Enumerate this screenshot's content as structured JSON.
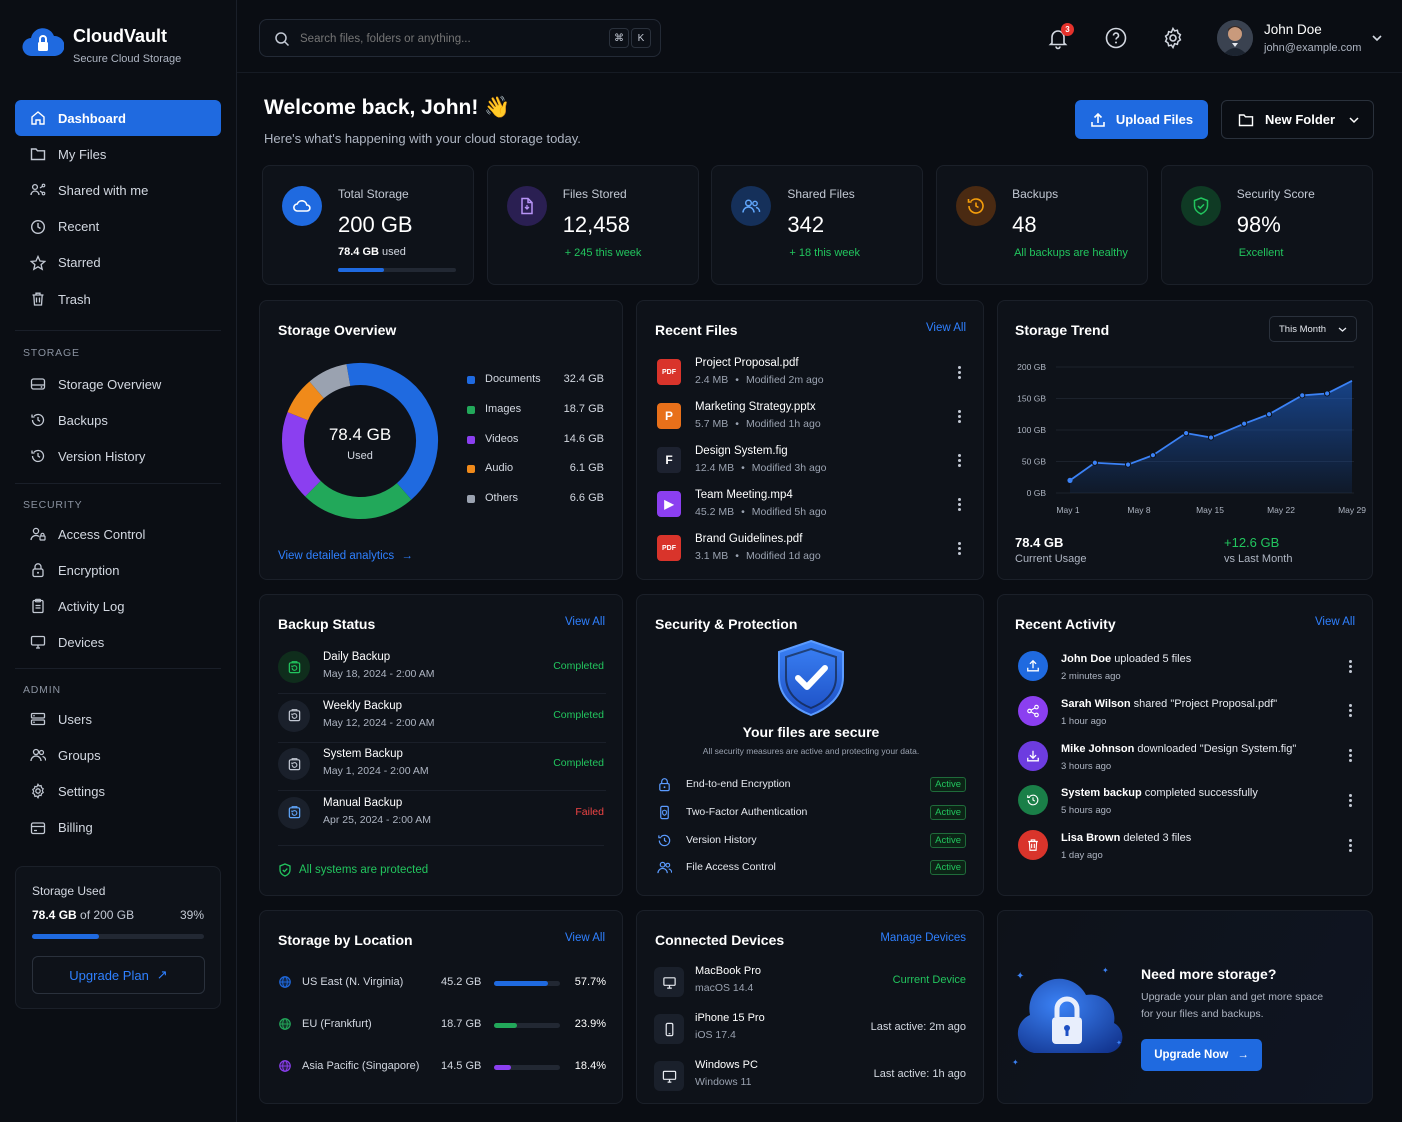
{
  "brand": {
    "name": "CloudVault",
    "tagline": "Secure Cloud Storage"
  },
  "nav": {
    "main": [
      {
        "label": "Dashboard",
        "icon": "home-icon",
        "active": true
      },
      {
        "label": "My Files",
        "icon": "folder-icon"
      },
      {
        "label": "Shared with me",
        "icon": "shared-users-icon"
      },
      {
        "label": "Recent",
        "icon": "clock-icon"
      },
      {
        "label": "Starred",
        "icon": "star-icon"
      },
      {
        "label": "Trash",
        "icon": "trash-icon"
      }
    ],
    "storage_heading": "STORAGE",
    "storage": [
      {
        "label": "Storage Overview",
        "icon": "hard-drive-icon"
      },
      {
        "label": "Backups",
        "icon": "backup-icon"
      },
      {
        "label": "Version History",
        "icon": "history-icon"
      }
    ],
    "security_heading": "SECURITY",
    "security": [
      {
        "label": "Access Control",
        "icon": "user-lock-icon"
      },
      {
        "label": "Encryption",
        "icon": "lock-icon"
      },
      {
        "label": "Activity Log",
        "icon": "clipboard-icon"
      },
      {
        "label": "Devices",
        "icon": "monitor-icon"
      }
    ],
    "admin_heading": "ADMIN",
    "admin": [
      {
        "label": "Users",
        "icon": "users-list-icon"
      },
      {
        "label": "Groups",
        "icon": "group-icon"
      },
      {
        "label": "Settings",
        "icon": "gear-icon"
      },
      {
        "label": "Billing",
        "icon": "wallet-icon"
      }
    ]
  },
  "sidebar_storage": {
    "title": "Storage Used",
    "used": "78.4 GB",
    "of": "of 200 GB",
    "percent_label": "39%",
    "percent": 0.39,
    "button": "Upgrade Plan"
  },
  "search": {
    "placeholder": "Search files, folders or anything...",
    "key1": "⌘",
    "key2": "K"
  },
  "notifications": {
    "count": "3"
  },
  "user": {
    "name": "John Doe",
    "email": "john@example.com"
  },
  "header": {
    "title": "Welcome back, John! 👋",
    "subtitle": "Here's what's happening with your cloud storage today.",
    "upload": "Upload Files",
    "new_folder": "New Folder"
  },
  "stats": [
    {
      "label": "Total Storage",
      "value": "200 GB",
      "sub": "78.4 GB",
      "sub_suffix": "used",
      "progress": 0.39
    },
    {
      "label": "Files Stored",
      "value": "12,458",
      "sub": "+ 245 this week"
    },
    {
      "label": "Shared Files",
      "value": "342",
      "sub": "+ 18 this week"
    },
    {
      "label": "Backups",
      "value": "48",
      "sub": "All backups are healthy"
    },
    {
      "label": "Security Score",
      "value": "98%",
      "sub": "Excellent"
    }
  ],
  "overview": {
    "title": "Storage Overview",
    "center_value": "78.4 GB",
    "center_label": "Used",
    "link": "View detailed analytics",
    "items": [
      {
        "label": "Documents",
        "value": "32.4 GB",
        "gb": 32.4,
        "color": "#1f6ae0"
      },
      {
        "label": "Images",
        "value": "18.7 GB",
        "gb": 18.7,
        "color": "#22a85a"
      },
      {
        "label": "Videos",
        "value": "14.6 GB",
        "gb": 14.6,
        "color": "#8b3ff0"
      },
      {
        "label": "Audio",
        "value": "6.1 GB",
        "gb": 6.1,
        "color": "#f08a1a"
      },
      {
        "label": "Others",
        "value": "6.6 GB",
        "gb": 6.6,
        "color": "#9aa2b0"
      }
    ]
  },
  "recent_files": {
    "title": "Recent Files",
    "view_all": "View All",
    "items": [
      {
        "name": "Project Proposal.pdf",
        "size": "2.4 MB",
        "modified": "Modified 2m ago",
        "icon": "pdf-icon",
        "color": "#d9342b",
        "glyph": "PDF"
      },
      {
        "name": "Marketing Strategy.pptx",
        "size": "5.7 MB",
        "modified": "Modified 1h ago",
        "icon": "pptx-icon",
        "color": "#e8701a",
        "glyph": "P"
      },
      {
        "name": "Design System.fig",
        "size": "12.4 MB",
        "modified": "Modified 3h ago",
        "icon": "figma-icon",
        "color": "#1d2230",
        "glyph": "F"
      },
      {
        "name": "Team Meeting.mp4",
        "size": "45.2 MB",
        "modified": "Modified 5h ago",
        "icon": "video-icon",
        "color": "#8b3ff0",
        "glyph": "▶"
      },
      {
        "name": "Brand Guidelines.pdf",
        "size": "3.1 MB",
        "modified": "Modified 1d ago",
        "icon": "pdf-icon",
        "color": "#d9342b",
        "glyph": "PDF"
      }
    ]
  },
  "trend": {
    "title": "Storage Trend",
    "period": "This Month",
    "current_value": "78.4 GB",
    "current_label": "Current Usage",
    "delta_value": "+12.6 GB",
    "delta_label": "vs Last Month"
  },
  "chart_data": {
    "type": "area",
    "y_ticks": [
      "200 GB",
      "150 GB",
      "100 GB",
      "50 GB",
      "0 GB"
    ],
    "ylim": [
      0,
      200
    ],
    "x_ticks": [
      "May 1",
      "May 8",
      "May 15",
      "May 22",
      "May 29"
    ],
    "x": [
      1,
      4,
      8,
      11,
      15,
      18,
      22,
      25,
      29,
      32,
      35
    ],
    "y": [
      20,
      48,
      45,
      60,
      95,
      88,
      110,
      125,
      155,
      158,
      178
    ]
  },
  "backup": {
    "title": "Backup Status",
    "view_all": "View All",
    "footer": "All systems are protected",
    "items": [
      {
        "name": "Daily Backup",
        "date": "May 18, 2024 - 2:00 AM",
        "status": "Completed",
        "ok": true
      },
      {
        "name": "Weekly Backup",
        "date": "May 12, 2024 - 2:00 AM",
        "status": "Completed",
        "ok": true
      },
      {
        "name": "System Backup",
        "date": "May 1, 2024 - 2:00 AM",
        "status": "Completed",
        "ok": true
      },
      {
        "name": "Manual Backup",
        "date": "Apr 25, 2024 - 2:00 AM",
        "status": "Failed",
        "ok": false
      }
    ]
  },
  "security": {
    "title": "Security & Protection",
    "heading": "Your files are secure",
    "sub": "All security measures are active and protecting your data.",
    "items": [
      {
        "label": "End-to-end Encryption",
        "status": "Active",
        "icon": "lock-icon"
      },
      {
        "label": "Two-Factor Authentication",
        "status": "Active",
        "icon": "phone-shield-icon"
      },
      {
        "label": "Version History",
        "status": "Active",
        "icon": "history-icon"
      },
      {
        "label": "File Access Control",
        "status": "Active",
        "icon": "users-icon"
      }
    ]
  },
  "activity": {
    "title": "Recent Activity",
    "view_all": "View All",
    "items": [
      {
        "actor": "John Doe",
        "action": "uploaded 5 files",
        "time": "2 minutes ago",
        "color": "#1f6ae0",
        "icon": "upload-icon"
      },
      {
        "actor": "Sarah Wilson",
        "action": "shared \"Project Proposal.pdf\"",
        "time": "1 hour ago",
        "color": "#8b3ff0",
        "icon": "share-icon"
      },
      {
        "actor": "Mike Johnson",
        "action": "downloaded \"Design System.fig\"",
        "time": "3 hours ago",
        "color": "#6d3ce0",
        "icon": "download-icon"
      },
      {
        "actor": "System backup",
        "action": "completed successfully",
        "time": "5 hours ago",
        "color": "#1a7f48",
        "icon": "backup-icon"
      },
      {
        "actor": "Lisa Brown",
        "action": "deleted 3 files",
        "time": "1 day ago",
        "color": "#d9342b",
        "icon": "trash-icon"
      }
    ]
  },
  "locations": {
    "title": "Storage by Location",
    "view_all": "View All",
    "items": [
      {
        "name": "US East (N. Virginia)",
        "size": "45.2 GB",
        "percent": "57.7%",
        "fraction": 0.577,
        "color": "#1f6ae0"
      },
      {
        "name": "EU (Frankfurt)",
        "size": "18.7 GB",
        "percent": "23.9%",
        "fraction": 0.239,
        "color": "#22a85a"
      },
      {
        "name": "Asia Pacific (Singapore)",
        "size": "14.5 GB",
        "percent": "18.4%",
        "fraction": 0.184,
        "color": "#8b3ff0"
      }
    ]
  },
  "devices": {
    "title": "Connected Devices",
    "manage": "Manage Devices",
    "items": [
      {
        "name": "MacBook Pro",
        "os": "macOS 14.4",
        "status": "Current Device",
        "current": true,
        "icon": "laptop-icon"
      },
      {
        "name": "iPhone 15 Pro",
        "os": "iOS 17.4",
        "status": "Last active: 2m ago",
        "current": false,
        "icon": "phone-icon"
      },
      {
        "name": "Windows PC",
        "os": "Windows 11",
        "status": "Last active: 1h ago",
        "current": false,
        "icon": "desktop-icon"
      }
    ]
  },
  "promo": {
    "title": "Need more storage?",
    "text1": "Upgrade your plan and get more space",
    "text2": "for your files and backups.",
    "button": "Upgrade Now"
  }
}
